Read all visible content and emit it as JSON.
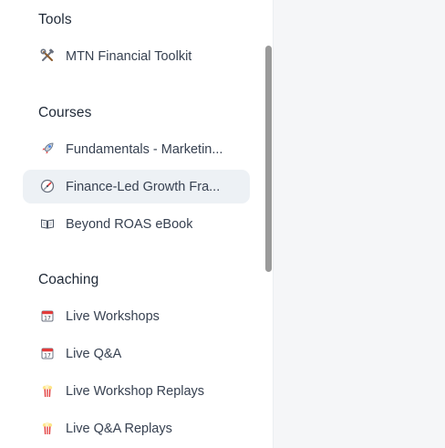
{
  "sidebar": {
    "sections": [
      {
        "heading": "Tools",
        "items": [
          {
            "label": "MTN Financial Toolkit",
            "icon": "hammer-wrench-icon"
          }
        ]
      },
      {
        "heading": "Courses",
        "items": [
          {
            "label": "Fundamentals - Marketin...",
            "icon": "rocket-icon"
          },
          {
            "label": "Finance-Led Growth Fra...",
            "icon": "compass-icon",
            "active": true
          },
          {
            "label": "Beyond ROAS eBook",
            "icon": "open-book-icon"
          }
        ]
      },
      {
        "heading": "Coaching",
        "items": [
          {
            "label": "Live Workshops",
            "icon": "calendar-icon"
          },
          {
            "label": "Live Q&A",
            "icon": "calendar-icon"
          },
          {
            "label": "Live Workshop Replays",
            "icon": "popcorn-icon"
          },
          {
            "label": "Live Q&A Replays",
            "icon": "popcorn-icon"
          }
        ]
      }
    ]
  },
  "colors": {
    "active_bg": "#edf1f5",
    "main_bg": "#f5f6f8",
    "text": "#374151",
    "heading": "#1f2937",
    "scrollbar": "#9a9a9a"
  }
}
